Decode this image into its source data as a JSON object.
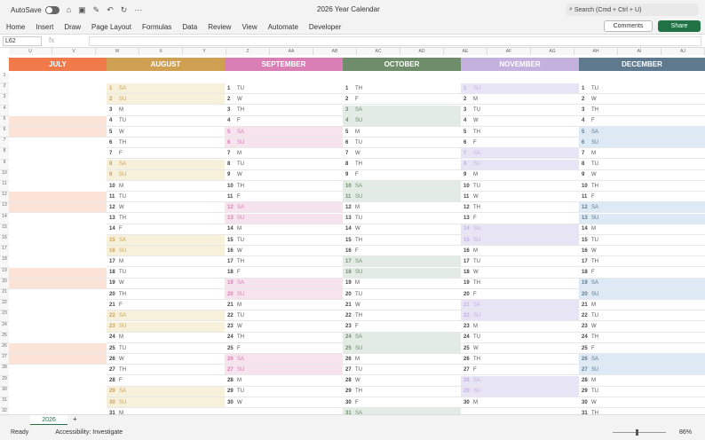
{
  "app": {
    "autosave_label": "AutoSave",
    "title": "2026 Year Calendar",
    "search_placeholder": "Search (Cmd + Ctrl + U)"
  },
  "menu": [
    "Home",
    "Insert",
    "Draw",
    "Page Layout",
    "Formulas",
    "Data",
    "Review",
    "View",
    "Automate",
    "Developer"
  ],
  "buttons": {
    "comments": "Comments",
    "share": "Share"
  },
  "formula_bar": {
    "name_box": "L62",
    "fx": "fx"
  },
  "col_headers": [
    "U",
    "V",
    "W",
    "X",
    "Y",
    "Z",
    "AA",
    "AB",
    "AC",
    "AD",
    "AE",
    "AF",
    "AG",
    "AH",
    "AI",
    "AJ"
  ],
  "months": [
    {
      "name": "JULY",
      "color": "#f07a4a",
      "light": "#fbe3d7",
      "days": []
    },
    {
      "name": "AUGUST",
      "color": "#cfa052",
      "light": "#f7f1dc",
      "days": [
        "SA",
        "SU",
        "M",
        "TU",
        "W",
        "TH",
        "F",
        "SA",
        "SU",
        "M",
        "TU",
        "W",
        "TH",
        "F",
        "SA",
        "SU",
        "M",
        "TU",
        "W",
        "TH",
        "F",
        "SA",
        "SU",
        "M",
        "TU",
        "W",
        "TH",
        "F",
        "SA",
        "SU",
        "M"
      ]
    },
    {
      "name": "SEPTEMBER",
      "color": "#d97fb6",
      "light": "#f6e3ee",
      "days": [
        "TU",
        "W",
        "TH",
        "F",
        "SA",
        "SU",
        "M",
        "TU",
        "W",
        "TH",
        "F",
        "SA",
        "SU",
        "M",
        "TU",
        "W",
        "TH",
        "F",
        "SA",
        "SU",
        "M",
        "TU",
        "W",
        "TH",
        "F",
        "SA",
        "SU",
        "M",
        "TU",
        "W"
      ]
    },
    {
      "name": "OCTOBER",
      "color": "#6f8d6b",
      "light": "#e2ebe4",
      "days": [
        "TH",
        "F",
        "SA",
        "SU",
        "M",
        "TU",
        "W",
        "TH",
        "F",
        "SA",
        "SU",
        "M",
        "TU",
        "W",
        "TH",
        "F",
        "SA",
        "SU",
        "M",
        "TU",
        "W",
        "TH",
        "F",
        "SA",
        "SU",
        "M",
        "TU",
        "W",
        "TH",
        "F",
        "SA"
      ]
    },
    {
      "name": "NOVEMBER",
      "color": "#c4b1dd",
      "light": "#e7e4f6",
      "days": [
        "SU",
        "M",
        "TU",
        "W",
        "TH",
        "F",
        "SA",
        "SU",
        "M",
        "TU",
        "W",
        "TH",
        "F",
        "SA",
        "SU",
        "M",
        "TU",
        "W",
        "TH",
        "F",
        "SA",
        "SU",
        "M",
        "TU",
        "W",
        "TH",
        "F",
        "SA",
        "SU",
        "M"
      ]
    },
    {
      "name": "DECEMBER",
      "color": "#5f7a8f",
      "light": "#dde9f5",
      "days": [
        "TU",
        "W",
        "TH",
        "F",
        "SA",
        "SU",
        "M",
        "TU",
        "W",
        "TH",
        "F",
        "SA",
        "SU",
        "M",
        "TU",
        "W",
        "TH",
        "F",
        "SA",
        "SU",
        "M",
        "TU",
        "W",
        "TH",
        "F",
        "SA",
        "SU",
        "M",
        "TU",
        "W",
        "TH"
      ]
    }
  ],
  "july_weekend_rows": [
    5,
    6,
    12,
    13,
    19,
    20,
    26,
    27
  ],
  "sheet": {
    "tab": "2026",
    "add": "+"
  },
  "status": {
    "ready": "Ready",
    "accessibility": "Accessibility: Investigate",
    "zoom": "86%"
  }
}
